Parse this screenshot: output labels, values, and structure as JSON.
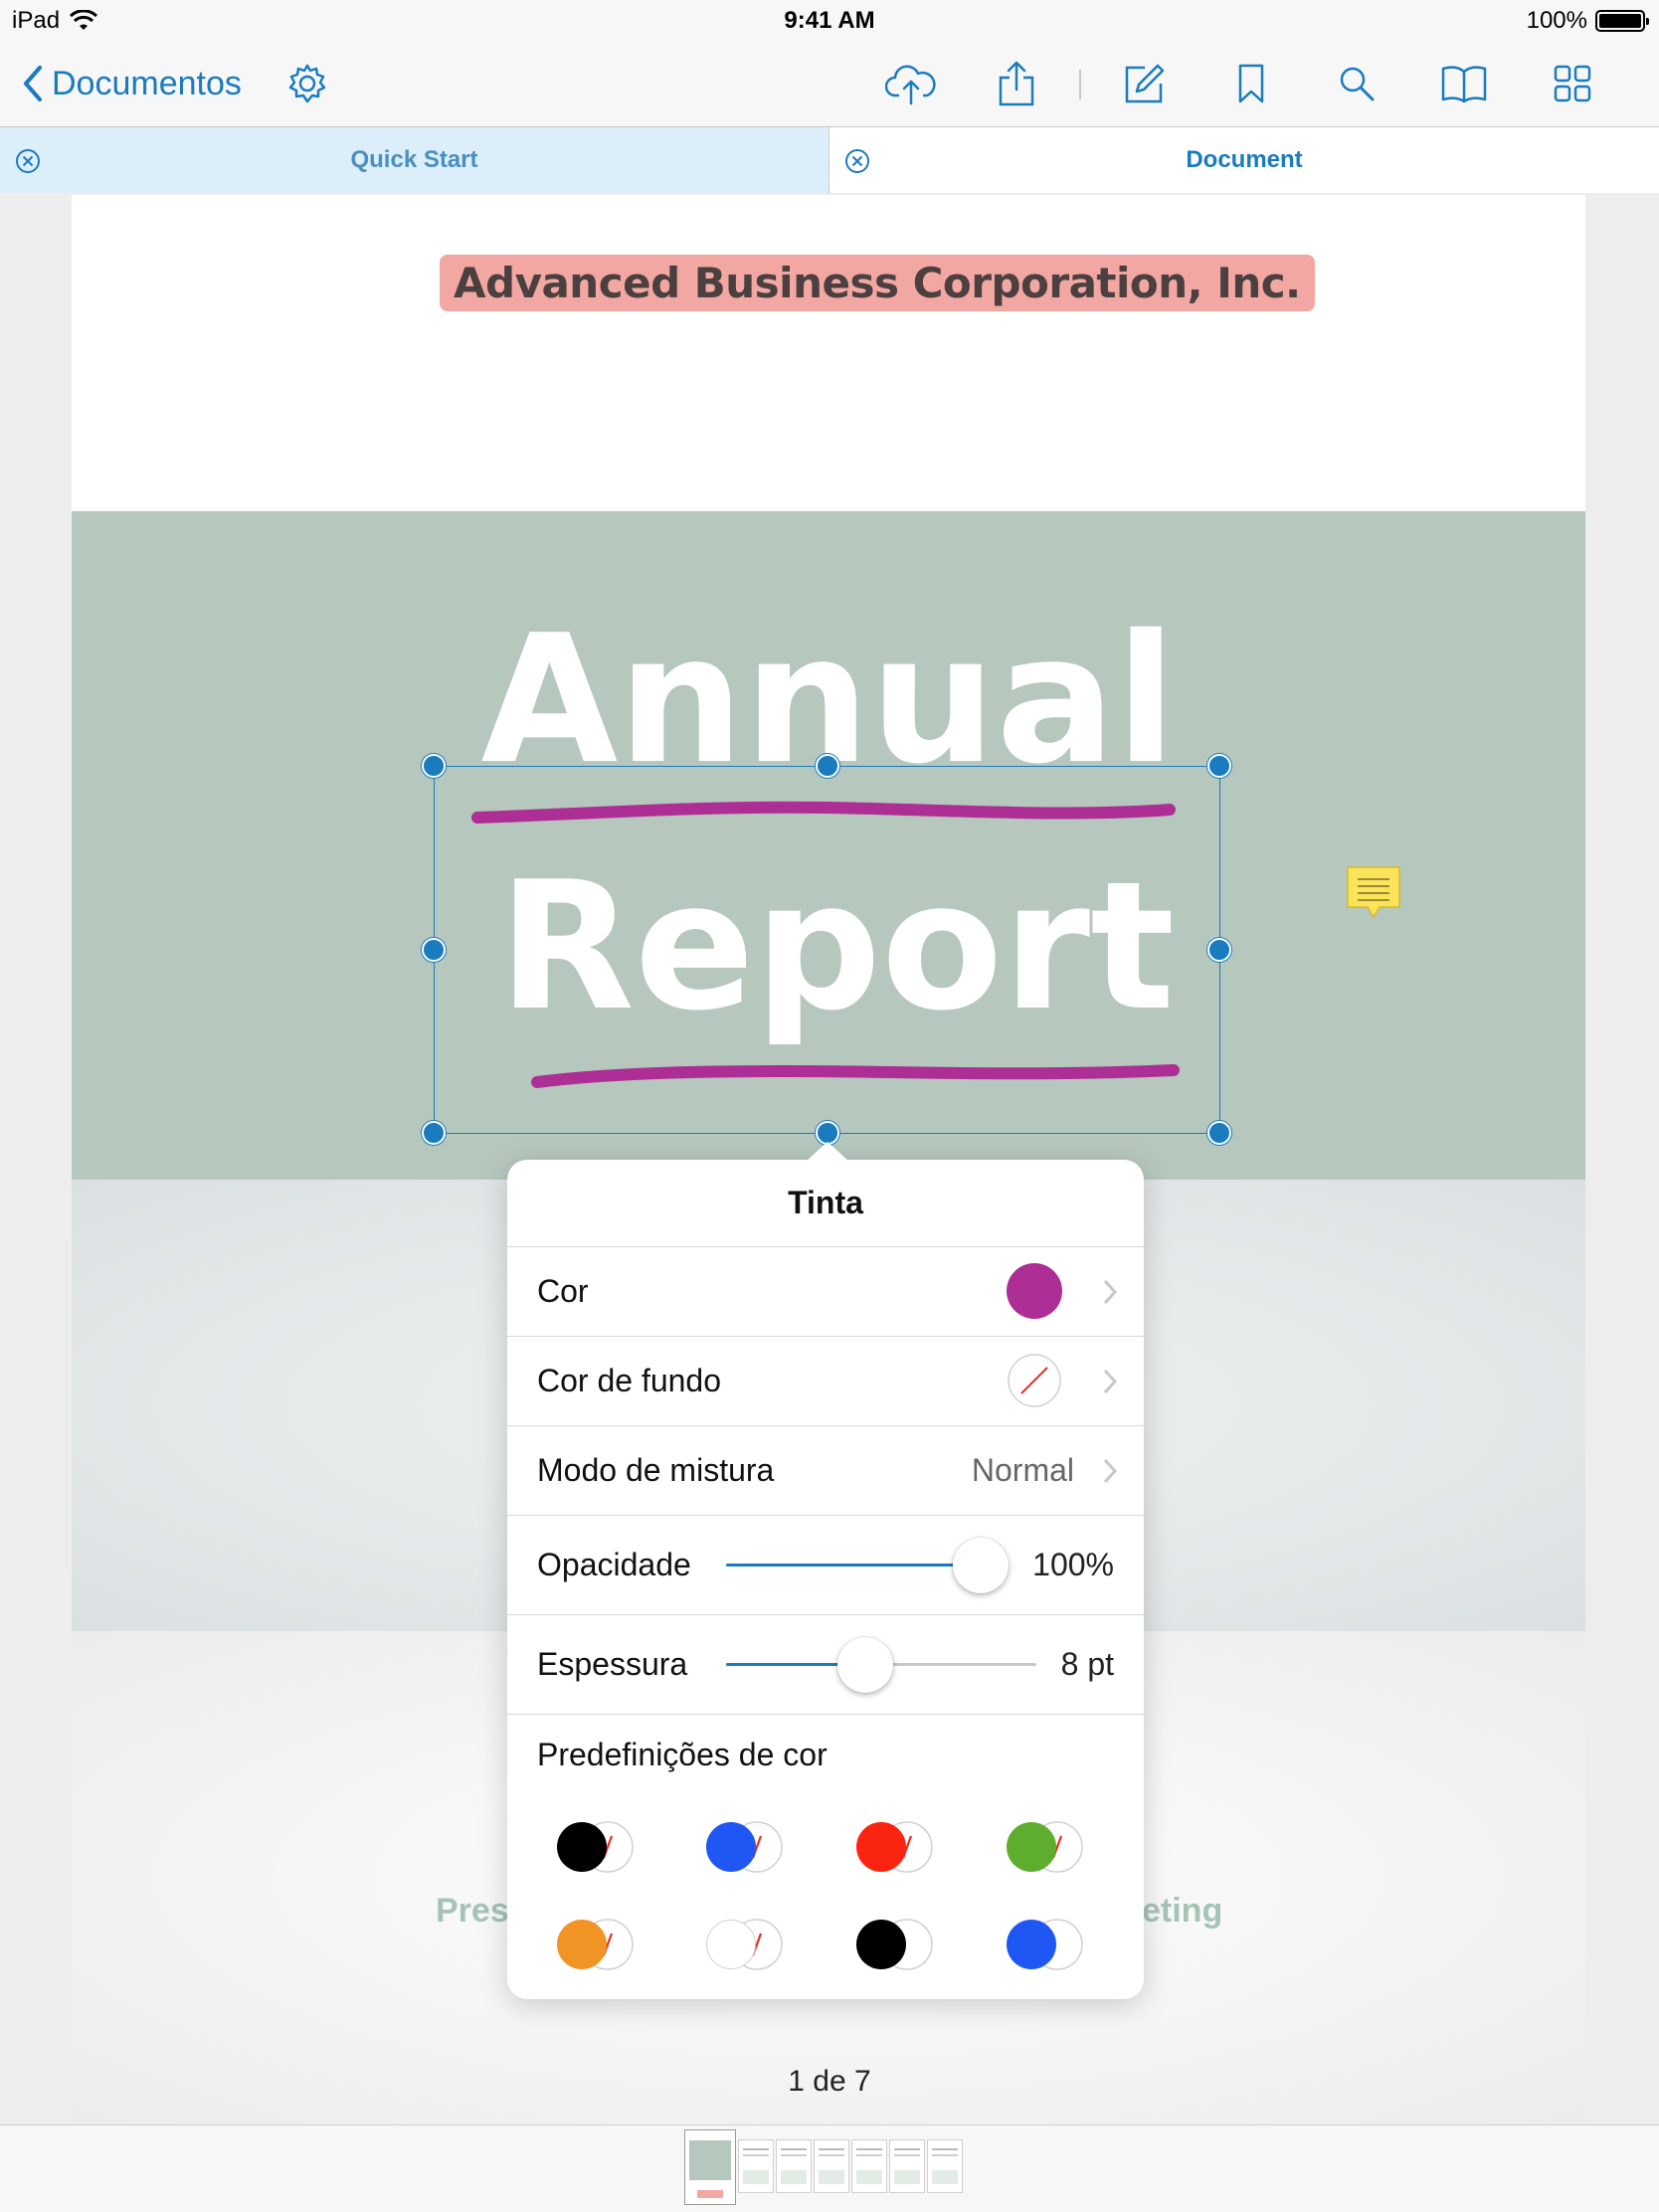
{
  "status_bar": {
    "device": "iPad",
    "time": "9:41 AM",
    "battery": "100%"
  },
  "toolbar": {
    "back_label": "Documentos",
    "icons": [
      "gear-icon",
      "cloud-upload-icon",
      "share-icon",
      "edit-icon",
      "bookmark-icon",
      "search-icon",
      "book-icon",
      "grid-icon"
    ]
  },
  "tabs": [
    {
      "label": "Quick Start",
      "active": false
    },
    {
      "label": "Document",
      "active": true
    }
  ],
  "document": {
    "company": "Advanced Business Corporation, Inc.",
    "title_line1": "Annual",
    "title_line2": "Report",
    "subtitle_left": "Pres",
    "subtitle_right": "eting",
    "page_indicator": "1 de 7"
  },
  "ink_popover": {
    "title": "Tinta",
    "color_label": "Cor",
    "color_value": "#ad2e94",
    "fill_label": "Cor de fundo",
    "blend_label": "Modo de mistura",
    "blend_value": "Normal",
    "opacity_label": "Opacidade",
    "opacity_value": "100%",
    "opacity_fraction": 1.0,
    "thickness_label": "Espessura",
    "thickness_value": "8 pt",
    "thickness_fraction": 0.45,
    "presets_label": "Predefinições de cor",
    "presets": [
      {
        "stroke": "#000000",
        "fill": "none"
      },
      {
        "stroke": "#1f57f5",
        "fill": "none"
      },
      {
        "stroke": "#fb2410",
        "fill": "none"
      },
      {
        "stroke": "#5fad2f",
        "fill": "none"
      },
      {
        "stroke": "#f29425",
        "fill": "none"
      },
      {
        "stroke": "#ffffff",
        "fill": "none"
      },
      {
        "stroke": "#000000",
        "fill": "#ffffff"
      },
      {
        "stroke": "#1f57f5",
        "fill": "#ffffff"
      }
    ]
  },
  "colors": {
    "accent": "#1a7bbf",
    "hero_bg": "#b6c7bd",
    "ink": "#ad2e94",
    "highlight": "#f2a7a2"
  },
  "thumbnails": {
    "count": 7,
    "active_index": 0
  }
}
